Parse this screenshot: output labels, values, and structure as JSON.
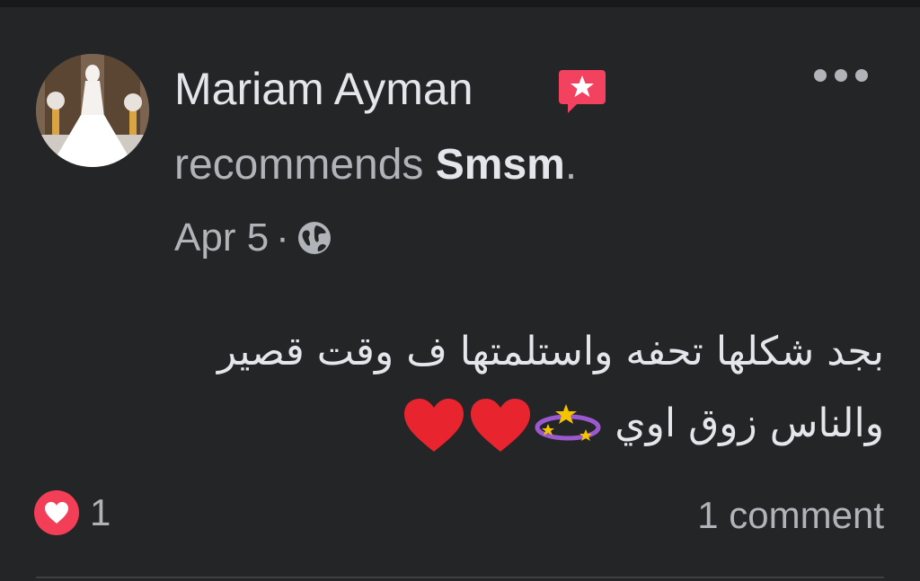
{
  "post": {
    "author": "Mariam Ayman",
    "recommends_word": "recommends",
    "page_name": "Smsm",
    "period": ".",
    "date": "Apr 5",
    "separator": "·",
    "text_line1": "بجد شكلها تحفه واستلمتها ف وقت قصير",
    "text_line2": "والناس زوق اوي",
    "reaction_count": "1",
    "comments_label": "1 comment"
  },
  "icons": {
    "badge": "recommendation-badge-icon",
    "privacy": "globe-icon",
    "more": "more-options-icon",
    "reaction": "heart-icon",
    "emoji_hearts": "red-heart-emoji",
    "emoji_stars": "dizzy-stars-emoji"
  },
  "colors": {
    "background": "#242526",
    "primary_text": "#e4e6eb",
    "secondary_text": "#b0b3b8",
    "heart": "#f33e58",
    "badge": "#f3425f"
  }
}
